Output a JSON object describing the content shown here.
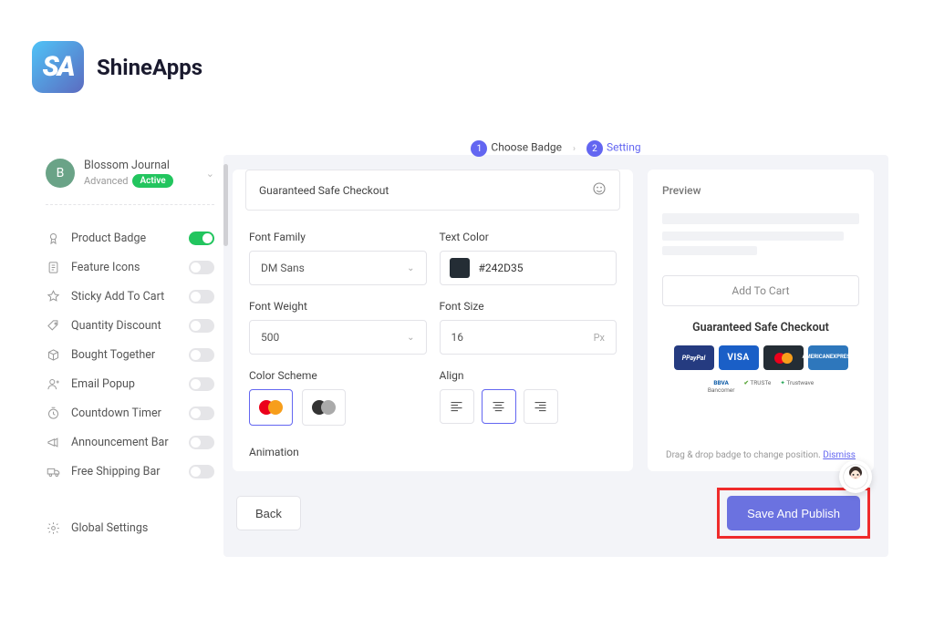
{
  "brand": {
    "logo": "SA",
    "name": "ShineApps"
  },
  "store": {
    "initial": "B",
    "name": "Blossom Journal",
    "plan": "Advanced",
    "status": "Active"
  },
  "nav": [
    {
      "label": "Product Badge",
      "on": true
    },
    {
      "label": "Feature Icons",
      "on": false
    },
    {
      "label": "Sticky Add To Cart",
      "on": false
    },
    {
      "label": "Quantity Discount",
      "on": false
    },
    {
      "label": "Bought Together",
      "on": false
    },
    {
      "label": "Email Popup",
      "on": false
    },
    {
      "label": "Countdown Timer",
      "on": false
    },
    {
      "label": "Announcement Bar",
      "on": false
    },
    {
      "label": "Free Shipping Bar",
      "on": false
    }
  ],
  "global": {
    "label": "Global Settings"
  },
  "steps": {
    "s1": "Choose Badge",
    "s2": "Setting"
  },
  "config": {
    "badge_title": "Guaranteed Safe Checkout",
    "labels": {
      "font_family": "Font Family",
      "text_color": "Text Color",
      "font_weight": "Font Weight",
      "font_size": "Font Size",
      "color_scheme": "Color Scheme",
      "align": "Align",
      "animation": "Animation"
    },
    "font_family": "DM Sans",
    "text_color": "#242D35",
    "font_weight": "500",
    "font_size": "16",
    "font_size_unit": "Px"
  },
  "preview": {
    "title": "Preview",
    "add_to_cart": "Add To Cart",
    "headline": "Guaranteed Safe Checkout",
    "hint": "Drag & drop badge to change position.",
    "dismiss": "Dismiss",
    "badges": {
      "paypal": "PayPal",
      "visa": "VISA",
      "amex_l1": "AMERICAN",
      "amex_l2": "EXPRESS"
    },
    "row2": {
      "bbva": "BBVA",
      "bancomer": "Bancomer",
      "truste": "TRUSTe",
      "trustwave": "Trustwave"
    }
  },
  "footer": {
    "back": "Back",
    "publish": "Save And Publish"
  }
}
